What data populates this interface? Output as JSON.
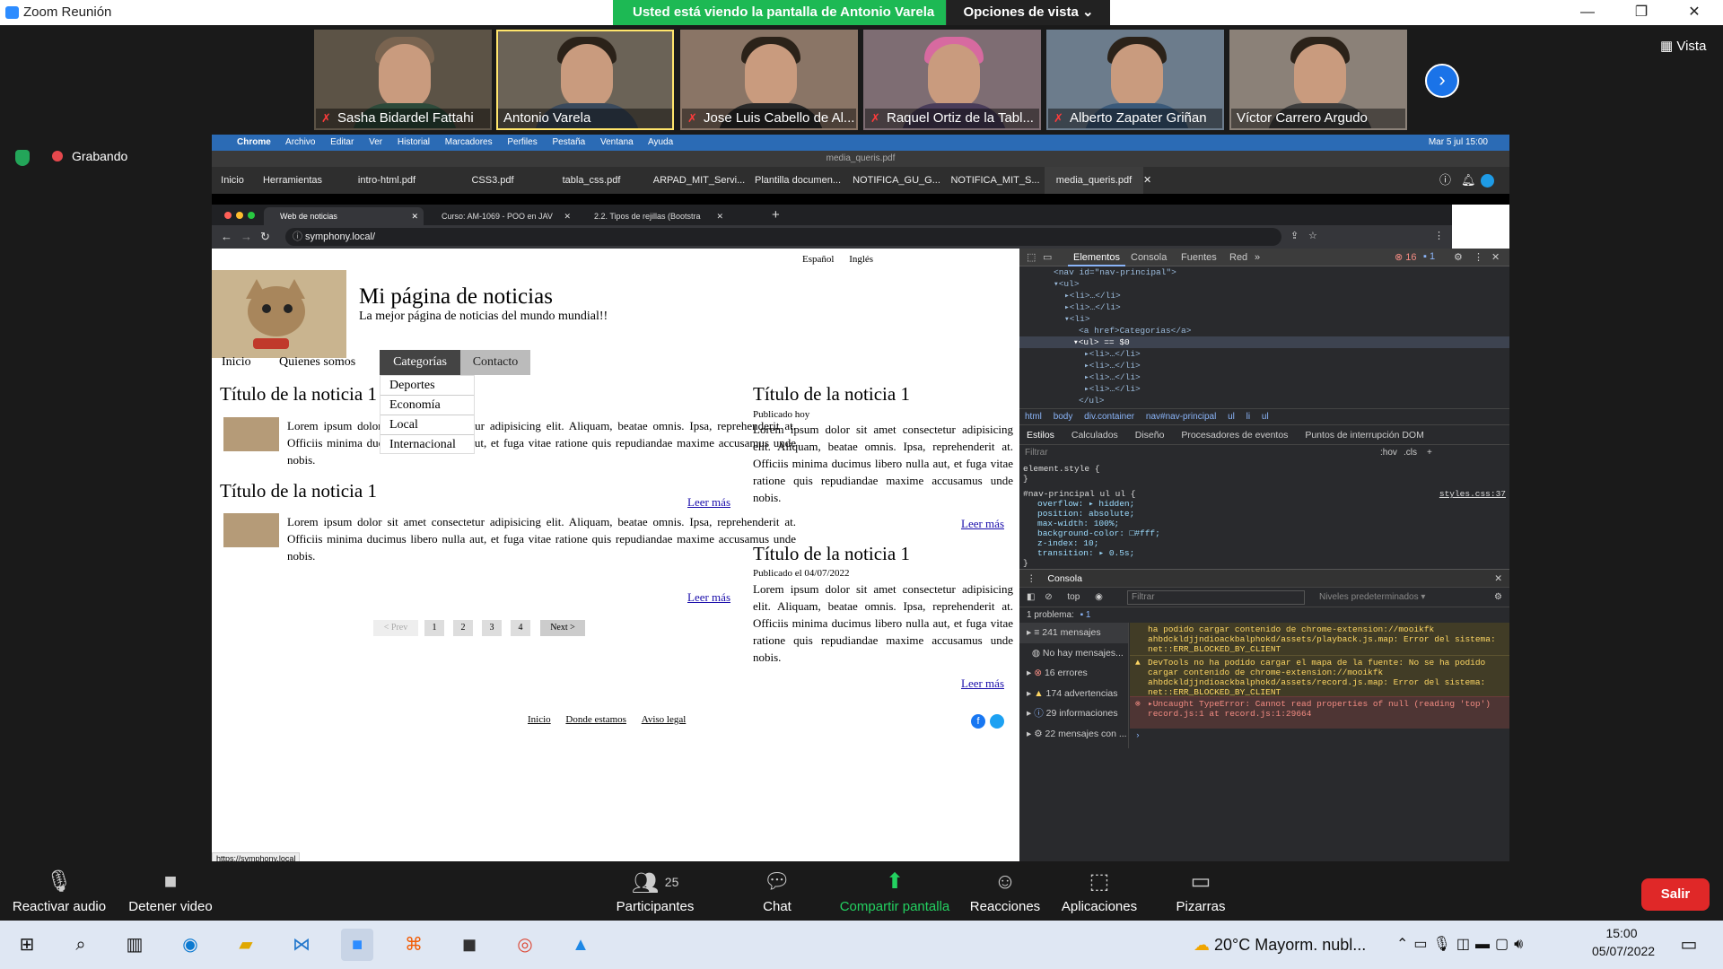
{
  "zoom": {
    "window_title": "Zoom Reunión",
    "share_banner": "Usted está viendo la pantalla de Antonio Varela",
    "view_options": "Opciones de vista ⌄",
    "vista_label": "Vista",
    "recording_label": "Grabando",
    "participants": [
      {
        "name": "Sasha Bidardel Fattahi",
        "muted": true
      },
      {
        "name": "Antonio Varela",
        "muted": false
      },
      {
        "name": "Jose Luis Cabello de Al...",
        "muted": true
      },
      {
        "name": "Raquel Ortiz de la Tabl...",
        "muted": true
      },
      {
        "name": "Alberto Zapater Griñan",
        "muted": true
      },
      {
        "name": "Víctor Carrero Argudo",
        "muted": false
      }
    ],
    "toolbar": {
      "audio": "Reactivar audio",
      "video": "Detener video",
      "participants": "Participantes",
      "participants_count": "25",
      "chat": "Chat",
      "share": "Compartir pantalla",
      "reactions": "Reacciones",
      "apps": "Aplicaciones",
      "whiteboards": "Pizarras",
      "leave": "Salir"
    }
  },
  "mac": {
    "menu": [
      "Chrome",
      "Archivo",
      "Editar",
      "Ver",
      "Historial",
      "Marcadores",
      "Perfiles",
      "Pestaña",
      "Ventana",
      "Ayuda"
    ],
    "clock": "Mar 5 jul  15:00"
  },
  "pdf_viewer": {
    "window_title": "media_queris.pdf",
    "tabs": [
      "Inicio",
      "Herramientas",
      "intro-html.pdf",
      "CSS3.pdf",
      "tabla_css.pdf",
      "ARPAD_MIT_Servi...",
      "Plantilla documen...",
      "NOTIFICA_GU_G...",
      "NOTIFICA_MIT_S...",
      "media_queris.pdf"
    ]
  },
  "chrome": {
    "tabs": [
      "Web de noticias",
      "Curso: AM-1069 - POO en JAV",
      "2.2. Tipos de rejillas (Bootstra"
    ],
    "url": "symphony.local/",
    "status_url": "https://symphony.local"
  },
  "site": {
    "lang": [
      "Español",
      "Inglés"
    ],
    "title": "Mi página de noticias",
    "subtitle": "La mejor página de noticias del mundo mundial!!",
    "nav": [
      "Inicio",
      "Quienes somos",
      "Categorías",
      "Contacto"
    ],
    "dropdown": [
      "Deportes",
      "Economía",
      "Local",
      "Internacional"
    ],
    "left_news": [
      {
        "title": "Título de la noticia 1",
        "body": "Lorem ipsum dolor sit amet consectetur adipisicing elit. Aliquam, beatae omnis. Ipsa, reprehenderit at. Officiis minima ducimus libero nulla aut, et fuga vitae ratione quis repudiandae maxime accusamus unde nobis.",
        "more": "Leer más"
      },
      {
        "title": "Título de la noticia 1",
        "body": "Lorem ipsum dolor sit amet consectetur adipisicing elit. Aliquam, beatae omnis. Ipsa, reprehenderit at. Officiis minima ducimus libero nulla aut, et fuga vitae ratione quis repudiandae maxime accusamus unde nobis.",
        "more": "Leer más"
      }
    ],
    "right_news": [
      {
        "title": "Título de la noticia 1",
        "published": "Publicado hoy",
        "body": "Lorem ipsum dolor sit amet consectetur adipisicing elit. Aliquam, beatae omnis. Ipsa, reprehenderit at. Officiis minima ducimus libero nulla aut, et fuga vitae ratione quis repudiandae maxime accusamus unde nobis.",
        "more": "Leer más"
      },
      {
        "title": "Título de la noticia 1",
        "published": "Publicado el 04/07/2022",
        "body": "Lorem ipsum dolor sit amet consectetur adipisicing elit. Aliquam, beatae omnis. Ipsa, reprehenderit at. Officiis minima ducimus libero nulla aut, et fuga vitae ratione quis repudiandae maxime accusamus unde nobis.",
        "more": "Leer más"
      }
    ],
    "pagination": [
      "< Prev",
      "1",
      "2",
      "3",
      "4",
      "Next >"
    ],
    "footer": [
      "Inicio",
      "Donde estamos",
      "Aviso legal"
    ]
  },
  "devtools": {
    "tabs": [
      "Elementos",
      "Consola",
      "Fuentes",
      "Red"
    ],
    "errors": "16",
    "issues": "1",
    "dom": [
      "<nav id=\"nav-principal\">",
      "▾<ul>",
      "▸<li>…</li>",
      "▸<li>…</li>",
      "▾<li>",
      "<a href>Categorías</a>",
      "▾<ul> == $0",
      "▸<li>…</li>",
      "▸<li>…</li>",
      "▸<li>…</li>",
      "▸<li>…</li>",
      "</ul>"
    ],
    "breadcrumb": [
      "html",
      "body",
      "div.container",
      "nav#nav-principal",
      "ul",
      "li",
      "ul"
    ],
    "style_tabs": [
      "Estilos",
      "Calculados",
      "Diseño",
      "Procesadores de eventos",
      "Puntos de interrupción DOM"
    ],
    "filter_placeholder": "Filtrar",
    "hov": ":hov",
    "cls": ".cls",
    "element_style": "element.style {",
    "rule_selector": "#nav-principal ul ul {",
    "rule_source": "styles.css:37",
    "rule_props": [
      "overflow: ▸ hidden;",
      "position: absolute;",
      "max-width: 100%;",
      "background-color: □#fff;",
      "z-index: 10;",
      "transition: ▸ 0.5s;"
    ],
    "console_title": "Consola",
    "console_context": "top",
    "console_filter": "Filtrar",
    "console_levels": "Niveles predeterminados ▾",
    "problems": "1 problema:",
    "problems_count": "1",
    "sidebar": [
      "241 mensajes",
      "No hay mensajes...",
      "16 errores",
      "174 advertencias",
      "29 informaciones",
      "22 mensajes con ..."
    ],
    "log_lines": [
      "ha podido cargar contenido de chrome-extension://mooikfk ahbdckldjjndioackbalphokd/assets/playback.js.map: Error del sistema: net::ERR_BLOCKED_BY_CLIENT",
      "DevTools no ha podido cargar el mapa de la fuente: No se ha podido cargar contenido de chrome-extension://mooikfk ahbdckldjjndioackbalphokd/assets/record.js.map: Error del sistema: net::ERR_BLOCKED_BY_CLIENT",
      "▸Uncaught TypeError: Cannot read properties of null (reading 'top')   record.js:1 at record.js:1:29664"
    ]
  },
  "taskbar": {
    "weather": "20°C  Mayorm. nubl...",
    "time": "15:00",
    "date": "05/07/2022"
  }
}
